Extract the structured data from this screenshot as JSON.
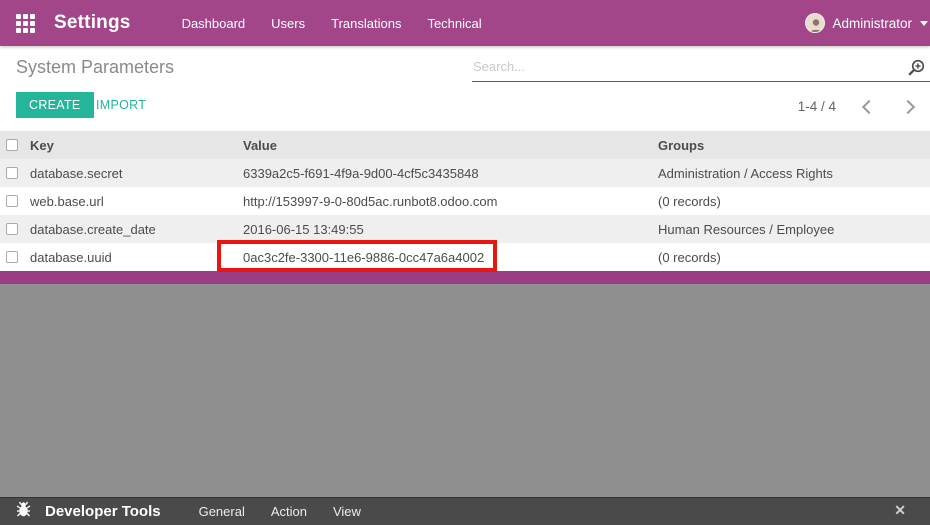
{
  "topbar": {
    "app_title": "Settings",
    "nav": [
      {
        "label": "Dashboard"
      },
      {
        "label": "Users"
      },
      {
        "label": "Translations"
      },
      {
        "label": "Technical"
      }
    ],
    "user": {
      "name": "Administrator"
    }
  },
  "control_panel": {
    "title": "System Parameters",
    "search_placeholder": "Search...",
    "create_label": "CREATE",
    "import_label": "IMPORT",
    "pager_range": "1-4 / 4"
  },
  "table": {
    "columns": [
      "Key",
      "Value",
      "Groups"
    ],
    "rows": [
      {
        "key": "database.secret",
        "value": "6339a2c5-f691-4f9a-9d00-4cf5c3435848",
        "groups": "Administration / Access Rights",
        "highlighted": false
      },
      {
        "key": "web.base.url",
        "value": "http://153997-9-0-80d5ac.runbot8.odoo.com",
        "groups": "(0 records)",
        "highlighted": false
      },
      {
        "key": "database.create_date",
        "value": "2016-06-15 13:49:55",
        "groups": "Human Resources / Employee",
        "highlighted": false
      },
      {
        "key": "database.uuid",
        "value": "0ac3c2fe-3300-11e6-9886-0cc47a6a4002",
        "groups": "(0 records)",
        "highlighted": true
      }
    ]
  },
  "dev_toolbar": {
    "title": "Developer Tools",
    "menu": [
      {
        "label": "General"
      },
      {
        "label": "Action"
      },
      {
        "label": "View"
      }
    ],
    "close_glyph": "✕"
  },
  "colors": {
    "brand": "#a24689",
    "accent_teal": "#24b59a",
    "highlight_red": "#e9150f"
  }
}
